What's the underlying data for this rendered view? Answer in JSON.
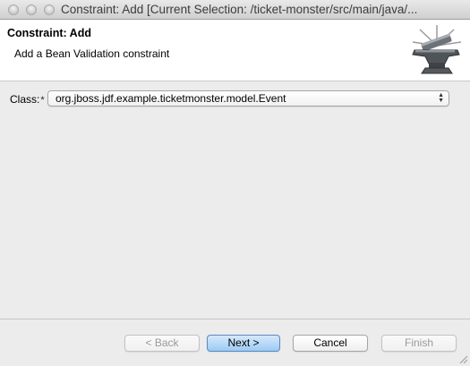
{
  "window": {
    "title": "Constraint: Add [Current Selection: /ticket-monster/src/main/java/..."
  },
  "banner": {
    "title": "Constraint: Add",
    "description": "Add a Bean Validation constraint",
    "art_icon": "anvil-wizard-icon"
  },
  "form": {
    "class_label": "Class:",
    "required_marker": "*",
    "class_value": "org.jboss.jdf.example.ticketmonster.model.Event"
  },
  "buttons": {
    "back": "< Back",
    "next": "Next >",
    "cancel": "Cancel",
    "finish": "Finish"
  },
  "colors": {
    "default_button": "#9ccbf4",
    "dialog_background": "#ececec"
  }
}
